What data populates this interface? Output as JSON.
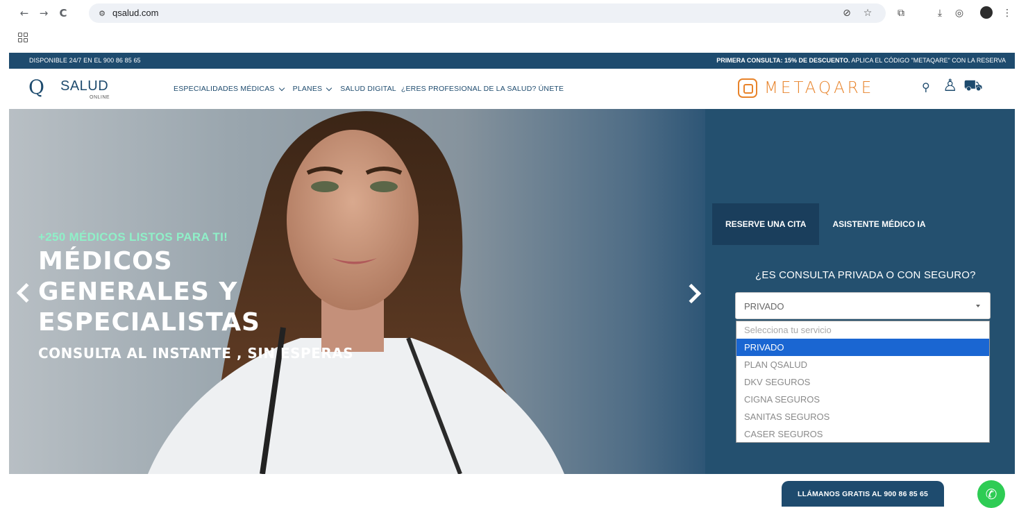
{
  "browser": {
    "url": "qsalud.com",
    "nav_back_icon": "←",
    "nav_forward_icon": "→",
    "reload_icon": "C",
    "site_info_icon": "⚙",
    "eye_off_icon": "⊘",
    "star_icon": "☆",
    "extensions_icon": "⧉",
    "download_icon": "⤓",
    "profile_icon": "◎",
    "menu_icon": "⋮"
  },
  "topbar": {
    "left_text": "DISPONIBLE 24/7 EN EL 900 86 85 65",
    "promo_bold": "PRIMERA CONSULTA: 15% DE DESCUENTO.",
    "promo_rest": " APLICA EL CÓDIGO \"METAQARE\" CON LA RESERVA"
  },
  "header": {
    "logo_q": "Q",
    "logo_salud": "SALUD",
    "logo_online": "ONLINE",
    "menu": [
      {
        "label": "ESPECIALIDADES MÉDICAS",
        "dropdown": true
      },
      {
        "label": "PLANES",
        "dropdown": true
      },
      {
        "label": "SALUD DIGITAL",
        "dropdown": false
      },
      {
        "label": "¿ERES PROFESIONAL DE LA SALUD? ÚNETE",
        "dropdown": false
      }
    ],
    "partner_logo": "METAQARE",
    "search_icon": "⚲",
    "user_icon": "♙",
    "cart_icon": "⛟"
  },
  "hero": {
    "subtitle": "+250 MÉDICOS LISTOS PARA TI!",
    "title_line1": "MÉDICOS",
    "title_line2": "GENERALES Y",
    "title_line3": "ESPECIALISTAS",
    "tagline": "CONSULTA AL INSTANTE , SIN ESPERAS"
  },
  "booking": {
    "tabs": [
      {
        "label": "RESERVE UNA CITA",
        "active": true
      },
      {
        "label": "ASISTENTE MÉDICO IA",
        "active": false
      }
    ],
    "question": "¿ES CONSULTA PRIVADA O CON SEGURO?",
    "select_value": "PRIVADO",
    "options": [
      {
        "label": "Selecciona tu servicio",
        "placeholder": true
      },
      {
        "label": "PRIVADO",
        "selected": true
      },
      {
        "label": "PLAN QSALUD"
      },
      {
        "label": "DKV SEGUROS"
      },
      {
        "label": "CIGNA SEGUROS"
      },
      {
        "label": "SANITAS SEGUROS"
      },
      {
        "label": "CASER SEGUROS"
      }
    ]
  },
  "footer": {
    "call_button": "LLÁMANOS GRATIS AL 900 86 85 65",
    "whatsapp_icon": "✆"
  },
  "colors": {
    "brand_navy": "#1e4b6e",
    "accent_orange": "#e8832a",
    "accent_mint": "#8ff0c8",
    "select_highlight": "#1a66d2",
    "whatsapp_green": "#2ecc54"
  }
}
